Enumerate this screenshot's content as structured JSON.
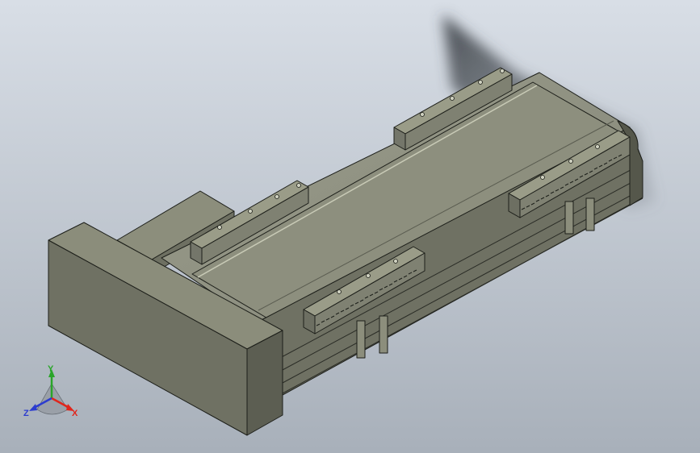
{
  "viewport": {
    "background_top": "#d6dce4",
    "background_bottom": "#a9b1ba",
    "model": "linear-actuator-stage"
  },
  "triad": {
    "x_label": "X",
    "y_label": "Y",
    "z_label": "Z",
    "x_color": "#e0261c",
    "y_color": "#2aa52a",
    "z_color": "#2c3ccf"
  },
  "colors": {
    "part_face_light": "#8f917e",
    "part_face_mid": "#7c7e6d",
    "part_face_dark": "#5f6154",
    "edge": "#1d1f1a",
    "shadow": "#5a6068"
  }
}
